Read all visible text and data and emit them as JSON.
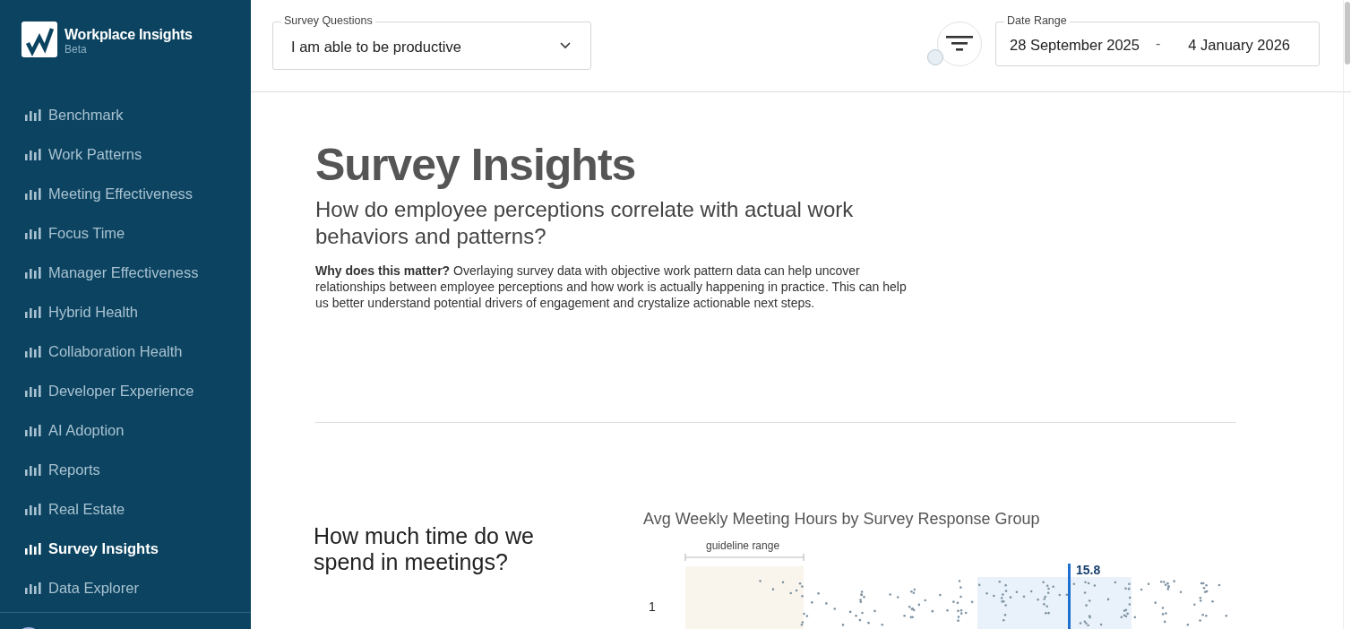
{
  "app": {
    "name": "Workplace Insights",
    "badge": "Beta"
  },
  "sidebar": {
    "items": [
      {
        "label": "Benchmark",
        "selected": false
      },
      {
        "label": "Work Patterns",
        "selected": false
      },
      {
        "label": "Meeting Effectiveness",
        "selected": false
      },
      {
        "label": "Focus Time",
        "selected": false
      },
      {
        "label": "Manager Effectiveness",
        "selected": false
      },
      {
        "label": "Hybrid Health",
        "selected": false
      },
      {
        "label": "Collaboration Health",
        "selected": false
      },
      {
        "label": "Developer Experience",
        "selected": false
      },
      {
        "label": "AI Adoption",
        "selected": false
      },
      {
        "label": "Reports",
        "selected": false
      },
      {
        "label": "Real Estate",
        "selected": false
      },
      {
        "label": "Survey Insights",
        "selected": true
      },
      {
        "label": "Data Explorer",
        "selected": false
      }
    ]
  },
  "toolbar": {
    "survey_questions": {
      "label": "Survey Questions",
      "value": "I am able to be productive"
    },
    "date_range": {
      "label": "Date Range",
      "start": "28 September 2025",
      "separator": "-",
      "end": "4 January 2026"
    }
  },
  "page": {
    "title": "Survey Insights",
    "subtitle": "How do employee perceptions correlate with actual work behaviors and patterns?",
    "description": "**Why does this matter?** Overlaying survey data with objective work pattern data can help uncover relationships between employee perceptions and how work is actually happening in practice. This can help us better understand potential drivers of engagement and crystalize actionable next steps."
  },
  "section": {
    "question": "How much time do we spend in meetings?",
    "chart": {
      "title": "Avg Weekly Meeting Hours by Survey Response Group",
      "guideline_label": "guideline range",
      "row_label": "1",
      "average_label": "15.8"
    }
  }
}
